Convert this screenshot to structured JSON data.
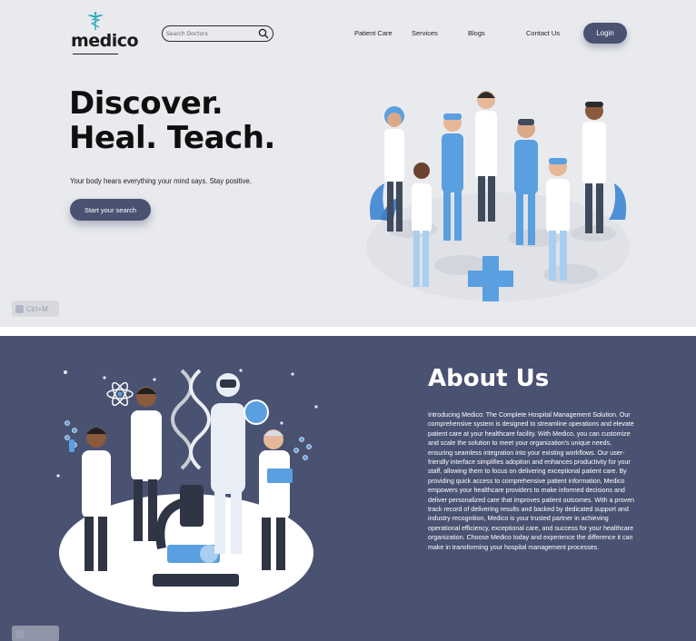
{
  "header": {
    "logo_text": "medico",
    "search": {
      "placeholder": "Search Doctors"
    },
    "nav": [
      "Patient Care",
      "Services",
      "Blogs",
      "Contact Us"
    ],
    "login_label": "Login"
  },
  "hero": {
    "title_line1": "Discover.",
    "title_line2": "Heal. Teach.",
    "subtitle": "Your body hears everything your mind says. Stay positive.",
    "cta_label": "Start your search"
  },
  "overlay": {
    "shortcut_label": "Ctrl+M"
  },
  "about": {
    "title": "About Us",
    "body": "Introducing Medico: The Complete Hospital Management Solution. Our comprehensive system is designed to streamline operations and elevate patient care at your healthcare facility. With Medico, you can customize and scale the solution to meet your organization's unique needs, ensuring seamless integration into your existing workflows. Our user-friendly interface simplifies adoption and enhances productivity for your staff, allowing them to focus on delivering exceptional patient care. By providing quick access to comprehensive patient information, Medico empowers your healthcare providers to make informed decisions and deliver personalized care that improves patient outcomes. With a proven track record of delivering results and backed by dedicated support and industry recognition, Medico is your trusted partner in achieving operational efficiency, exceptional care, and success for your healthcare organization. Choose Medico today and experience the difference it can make in transforming your hospital management processes."
  },
  "colors": {
    "accent": "#4a5272",
    "hero_bg": "#e9eaee",
    "logo_teal": "#2aa7b5"
  },
  "icons": [
    "caduceus-icon",
    "search-icon",
    "keyboard-icon"
  ]
}
